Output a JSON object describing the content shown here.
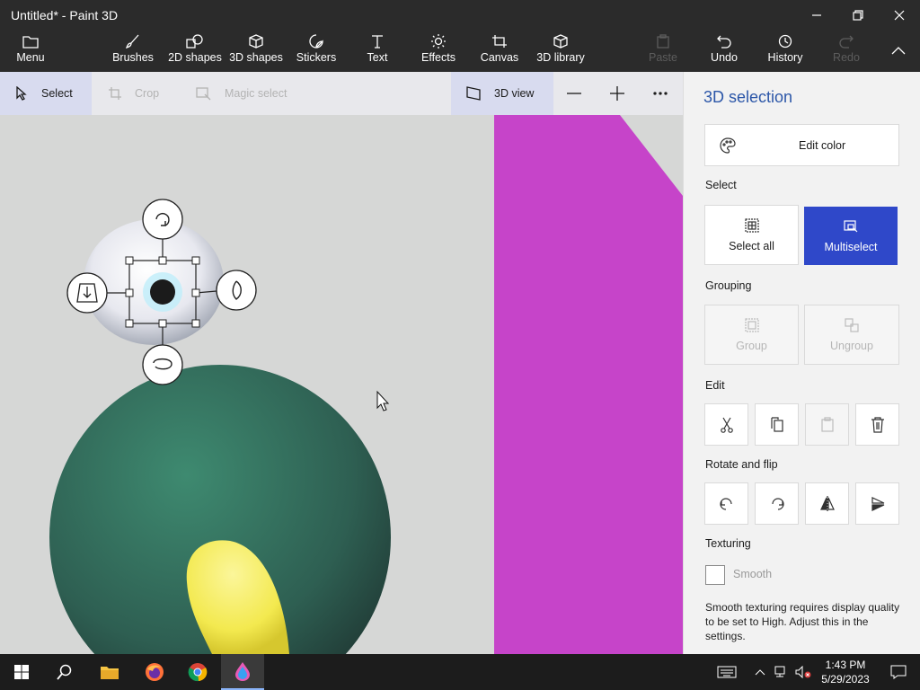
{
  "window": {
    "title": "Untitled* - Paint 3D"
  },
  "ribbon": {
    "menu": "Menu",
    "brushes": "Brushes",
    "shapes2d": "2D shapes",
    "shapes3d": "3D shapes",
    "stickers": "Stickers",
    "text": "Text",
    "effects": "Effects",
    "canvas": "Canvas",
    "library3d": "3D library",
    "paste": "Paste",
    "undo": "Undo",
    "history": "History",
    "redo": "Redo"
  },
  "toolbar": {
    "select": "Select",
    "crop": "Crop",
    "magic_select": "Magic select",
    "view3d": "3D view"
  },
  "panel": {
    "title": "3D selection",
    "edit_color": "Edit color",
    "select_heading": "Select",
    "select_all": "Select all",
    "multiselect": "Multiselect",
    "grouping_heading": "Grouping",
    "group": "Group",
    "ungroup": "Ungroup",
    "edit_heading": "Edit",
    "rotate_heading": "Rotate and flip",
    "texturing_heading": "Texturing",
    "smooth": "Smooth",
    "smooth_note": "Smooth texturing requires display quality to be set to High. Adjust this in the settings."
  },
  "taskbar": {
    "time": "1:43 PM",
    "date": "5/29/2023"
  },
  "colors": {
    "dark": "#2b2b2b",
    "accent": "#2f48c9",
    "magenta": "#c644c9",
    "green": "#2f6b56",
    "yellow": "#f3e94f"
  }
}
